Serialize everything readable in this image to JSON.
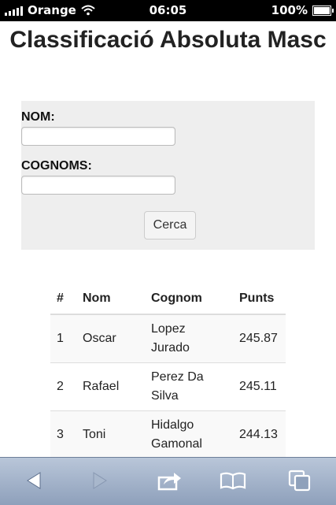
{
  "status_bar": {
    "carrier": "Orange",
    "time": "06:05",
    "battery": "100%"
  },
  "page": {
    "title": "Classificació Absoluta Masc"
  },
  "form": {
    "nom_label": "NOM:",
    "nom_value": "",
    "cognoms_label": "COGNOMS:",
    "cognoms_value": "",
    "search_label": "Cerca"
  },
  "table": {
    "headers": [
      "#",
      "Nom",
      "Cognom",
      "Punts"
    ],
    "rows": [
      {
        "rank": "1",
        "name": "Oscar",
        "surname": "Lopez Jurado",
        "points": "245.87"
      },
      {
        "rank": "2",
        "name": "Rafael",
        "surname": "Perez Da Silva",
        "points": "245.11"
      },
      {
        "rank": "3",
        "name": "Toni",
        "surname": "Hidalgo Gamonal",
        "points": "244.13"
      }
    ]
  },
  "toolbar": {
    "icons": [
      "back-arrow-icon",
      "forward-arrow-icon",
      "share-icon",
      "bookmarks-icon",
      "tabs-icon"
    ]
  }
}
